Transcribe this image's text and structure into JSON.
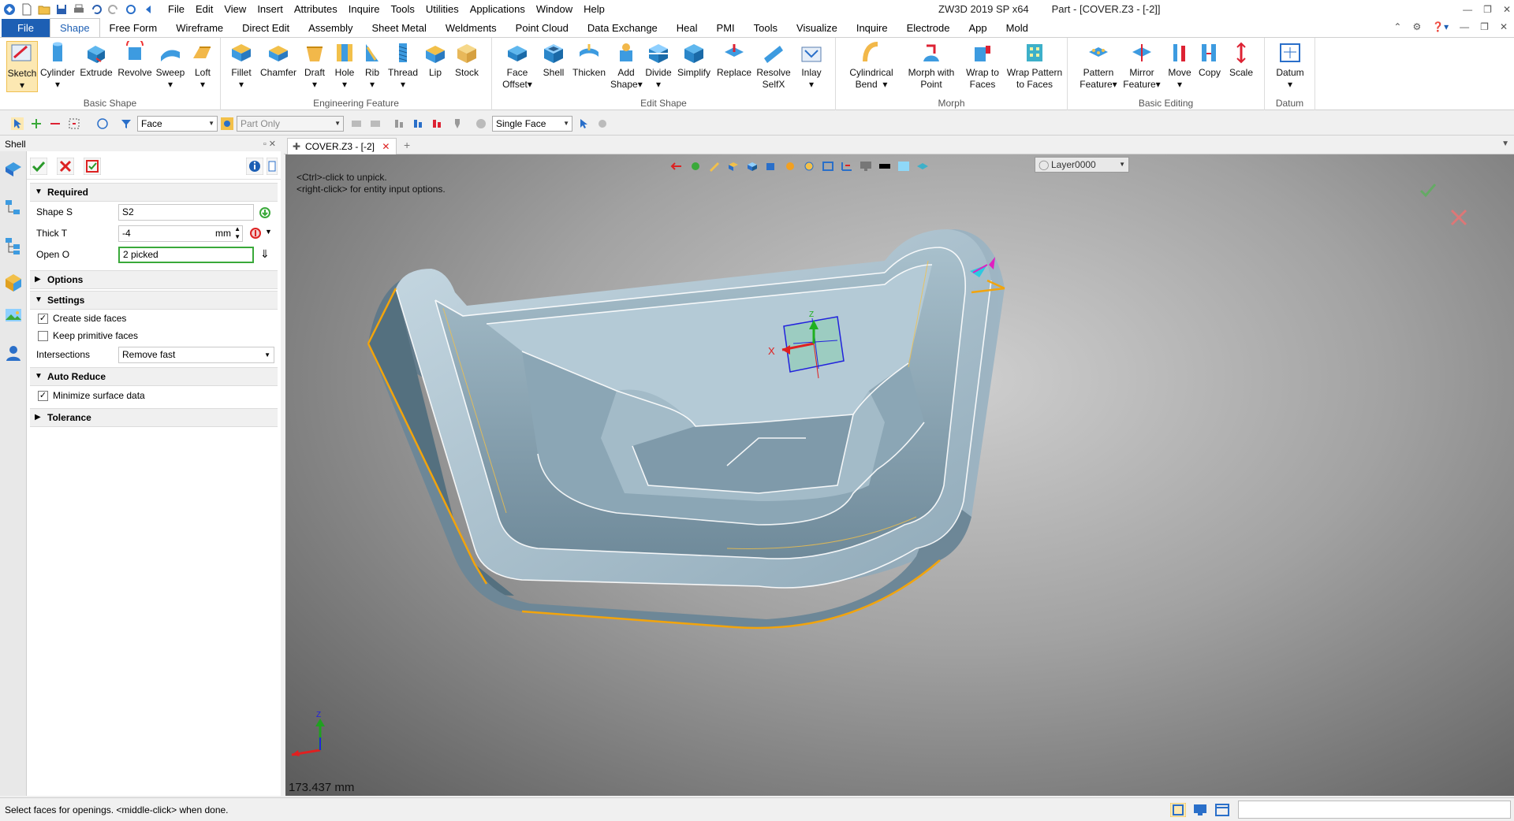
{
  "app": {
    "title": "ZW3D 2019 SP x64",
    "document": "Part - [COVER.Z3 - [-2]]"
  },
  "menu": [
    "File",
    "Edit",
    "View",
    "Insert",
    "Attributes",
    "Inquire",
    "Tools",
    "Utilities",
    "Applications",
    "Window",
    "Help"
  ],
  "tabs": [
    "File",
    "Shape",
    "Free Form",
    "Wireframe",
    "Direct Edit",
    "Assembly",
    "Sheet Metal",
    "Weldments",
    "Point Cloud",
    "Data Exchange",
    "Heal",
    "PMI",
    "Tools",
    "Visualize",
    "Inquire",
    "Electrode",
    "App",
    "Mold"
  ],
  "ribbon": {
    "groups": [
      "Basic Shape",
      "Engineering Feature",
      "Edit Shape",
      "Morph",
      "Basic Editing",
      "Datum"
    ],
    "basic_shape": [
      "Sketch",
      "Cylinder",
      "Extrude",
      "Revolve",
      "Sweep",
      "Loft"
    ],
    "engineering": [
      "Fillet",
      "Chamfer",
      "Draft",
      "Hole",
      "Rib",
      "Thread",
      "Lip",
      "Stock"
    ],
    "edit_shape": [
      [
        "Face",
        "Offset"
      ],
      [
        "Shell",
        ""
      ],
      [
        "Thicken",
        ""
      ],
      [
        "Add",
        "Shape"
      ],
      [
        "Divide",
        ""
      ],
      [
        "Simplify",
        ""
      ],
      [
        "Replace",
        ""
      ],
      [
        "Resolve",
        "SelfX"
      ],
      [
        "Inlay",
        ""
      ]
    ],
    "morph": [
      [
        "Cylindrical",
        "Bend"
      ],
      [
        "Morph with",
        "Point"
      ],
      [
        "Wrap to",
        "Faces"
      ],
      [
        "Wrap Pattern",
        "to Faces"
      ]
    ],
    "basic_editing": [
      [
        "Pattern",
        "Feature"
      ],
      [
        "Mirror",
        "Feature"
      ],
      [
        "Move",
        ""
      ],
      [
        "Copy",
        ""
      ],
      [
        "Scale",
        ""
      ]
    ],
    "datum": [
      "Datum"
    ]
  },
  "toolbar2": {
    "filter": "Face",
    "scope": "Part Only",
    "pick": "Single Face"
  },
  "panel": {
    "title": "Shell",
    "required": "Required",
    "fields": [
      {
        "label": "Shape S",
        "value": "S2"
      },
      {
        "label": "Thick T",
        "value": "-4",
        "unit": "mm"
      },
      {
        "label": "Open O",
        "value": "2 picked"
      }
    ],
    "options": "Options",
    "settings": "Settings",
    "create_side": "Create side faces",
    "keep_primitive": "Keep primitive faces",
    "intersections_label": "Intersections",
    "intersections_value": "Remove fast",
    "auto_reduce": "Auto Reduce",
    "minimize": "Minimize surface data",
    "tolerance": "Tolerance"
  },
  "doc_tab": "COVER.Z3 - [-2]",
  "viewport": {
    "layer": "Layer0000",
    "hint1": "<Ctrl>-click to unpick.",
    "hint2": "<right-click> for entity input options.",
    "distance": "173.437 mm",
    "axis_x": "X",
    "axis_z": "Z"
  },
  "status": "Select faces for openings.  <middle-click> when done."
}
